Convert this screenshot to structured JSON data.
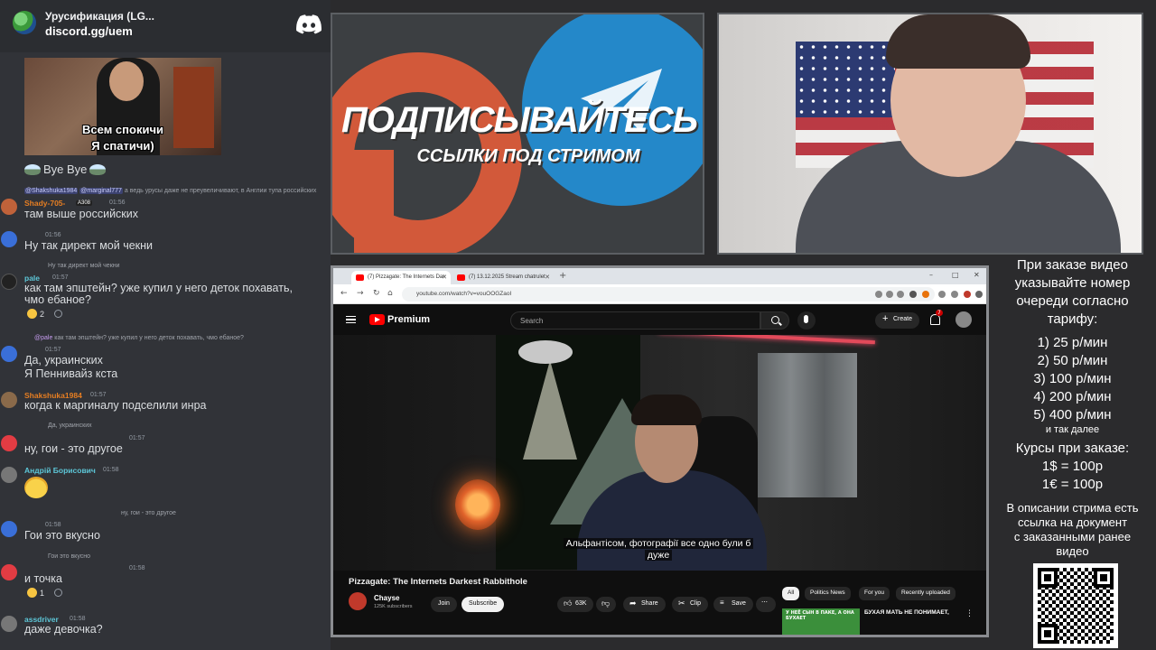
{
  "discord": {
    "server_name": "Урусификация (LG...",
    "invite_link": "discord.gg/uem",
    "video_caption_line1": "Всем спокичи",
    "video_caption_line2": "Я спатичи)",
    "bye_text": "Bye Bye",
    "messages": [
      {
        "reply_mention": "@Shakshuka1984",
        "reply_mention2": "@marginal777",
        "reply_text": "а ведь урусы даже не преувеличивают, в Англии тупа российских",
        "username": "Shady-705-",
        "badge": "A308",
        "time": "01:56",
        "text": "там выше российских",
        "color": "#e67e22"
      },
      {
        "time": "01:56",
        "text": "Ну так директ мой чекни"
      },
      {
        "reply_text": "Ну так директ мой чекни",
        "username": "pale",
        "time": "01:57",
        "text_line1": "как там эпштейн? уже купил у него деток похавать,",
        "text_line2": "чмо ебаное?",
        "reaction1": "2",
        "color": "#5dc7d8"
      },
      {
        "reply_mention": "@pale",
        "reply_text": "как там эпштейн? уже купил у него деток похавать, чмо ебаное?",
        "time": "01:57",
        "text_line1": "Да, украинских",
        "text_line2": "Я Пеннивайз кста"
      },
      {
        "username": "Shakshuka1984",
        "time": "01:57",
        "text": "когда к маргиналу подселили инра",
        "color": "#e67e22"
      },
      {
        "reply_text": "Да, украинских",
        "time": "01:57",
        "text": "ну, гои - это другое"
      },
      {
        "username": "Андрій Борисович",
        "time": "01:58",
        "color": "#5dc7d8"
      },
      {
        "reply_text": "ну, гои - это другое",
        "time": "01:58",
        "text": "Гои это вкусно"
      },
      {
        "reply_text": "Гои это вкусно",
        "time": "01:58",
        "text": "и точка",
        "reaction1": "1"
      },
      {
        "username": "assdriver",
        "time": "01:58",
        "text": "даже девочка?",
        "color": "#5dc7d8"
      }
    ]
  },
  "banner": {
    "title": "ПОДПИСЫВАЙТЕСЬ",
    "subtitle": "ССЫЛКИ ПОД СТРИМОМ"
  },
  "browser": {
    "tab1_title": "(7) Pizzagate: The Internets Dar",
    "tab2_title": "(7) 13.12.2025 Stream chatrulet",
    "url": "youtube.com/watch?v=vouOOGZaoI",
    "search_placeholder": "Search",
    "premium_label": "Premium",
    "create_label": "Create",
    "notif_count": "7",
    "subtitle_line1": "Альфантісом, фотографії все одно були б",
    "subtitle_line2": "дуже",
    "video_title": "Pizzagate: The Internets Darkest Rabbithole",
    "channel_name": "Chayse",
    "channel_subs": "125K subscribers",
    "join_label": "Join",
    "subscribe_label": "Subscribe",
    "likes": "63K",
    "share_label": "Share",
    "clip_label": "Clip",
    "save_label": "Save",
    "chips": [
      "All",
      "Politics News",
      "For you",
      "Recently uploaded"
    ],
    "rec_thumb_text": "У НЕЁ СЫН В ПАКЕ, А ОНА БУХАЕТ",
    "rec_title": "БУХАЯ МАТЬ НЕ ПОНИМАЕТ,"
  },
  "info": {
    "line1": "При заказе видео",
    "line2": "указывайте номер",
    "line3": "очереди согласно",
    "line4": "тарифу:",
    "tariffs": [
      "1) 25 р/мин",
      "2) 50 р/мин",
      "3) 100 р/мин",
      "4) 200 р/мин",
      "5) 400 р/мин"
    ],
    "and_more": "и так далее",
    "courses_title": "Курсы при заказе:",
    "course1": "1$ = 100р",
    "course2": "1€ = 100р",
    "desc1": "В описании стрима есть",
    "desc2": "ссылка на документ",
    "desc3": "с заказанными ранее",
    "desc4": "видео"
  }
}
